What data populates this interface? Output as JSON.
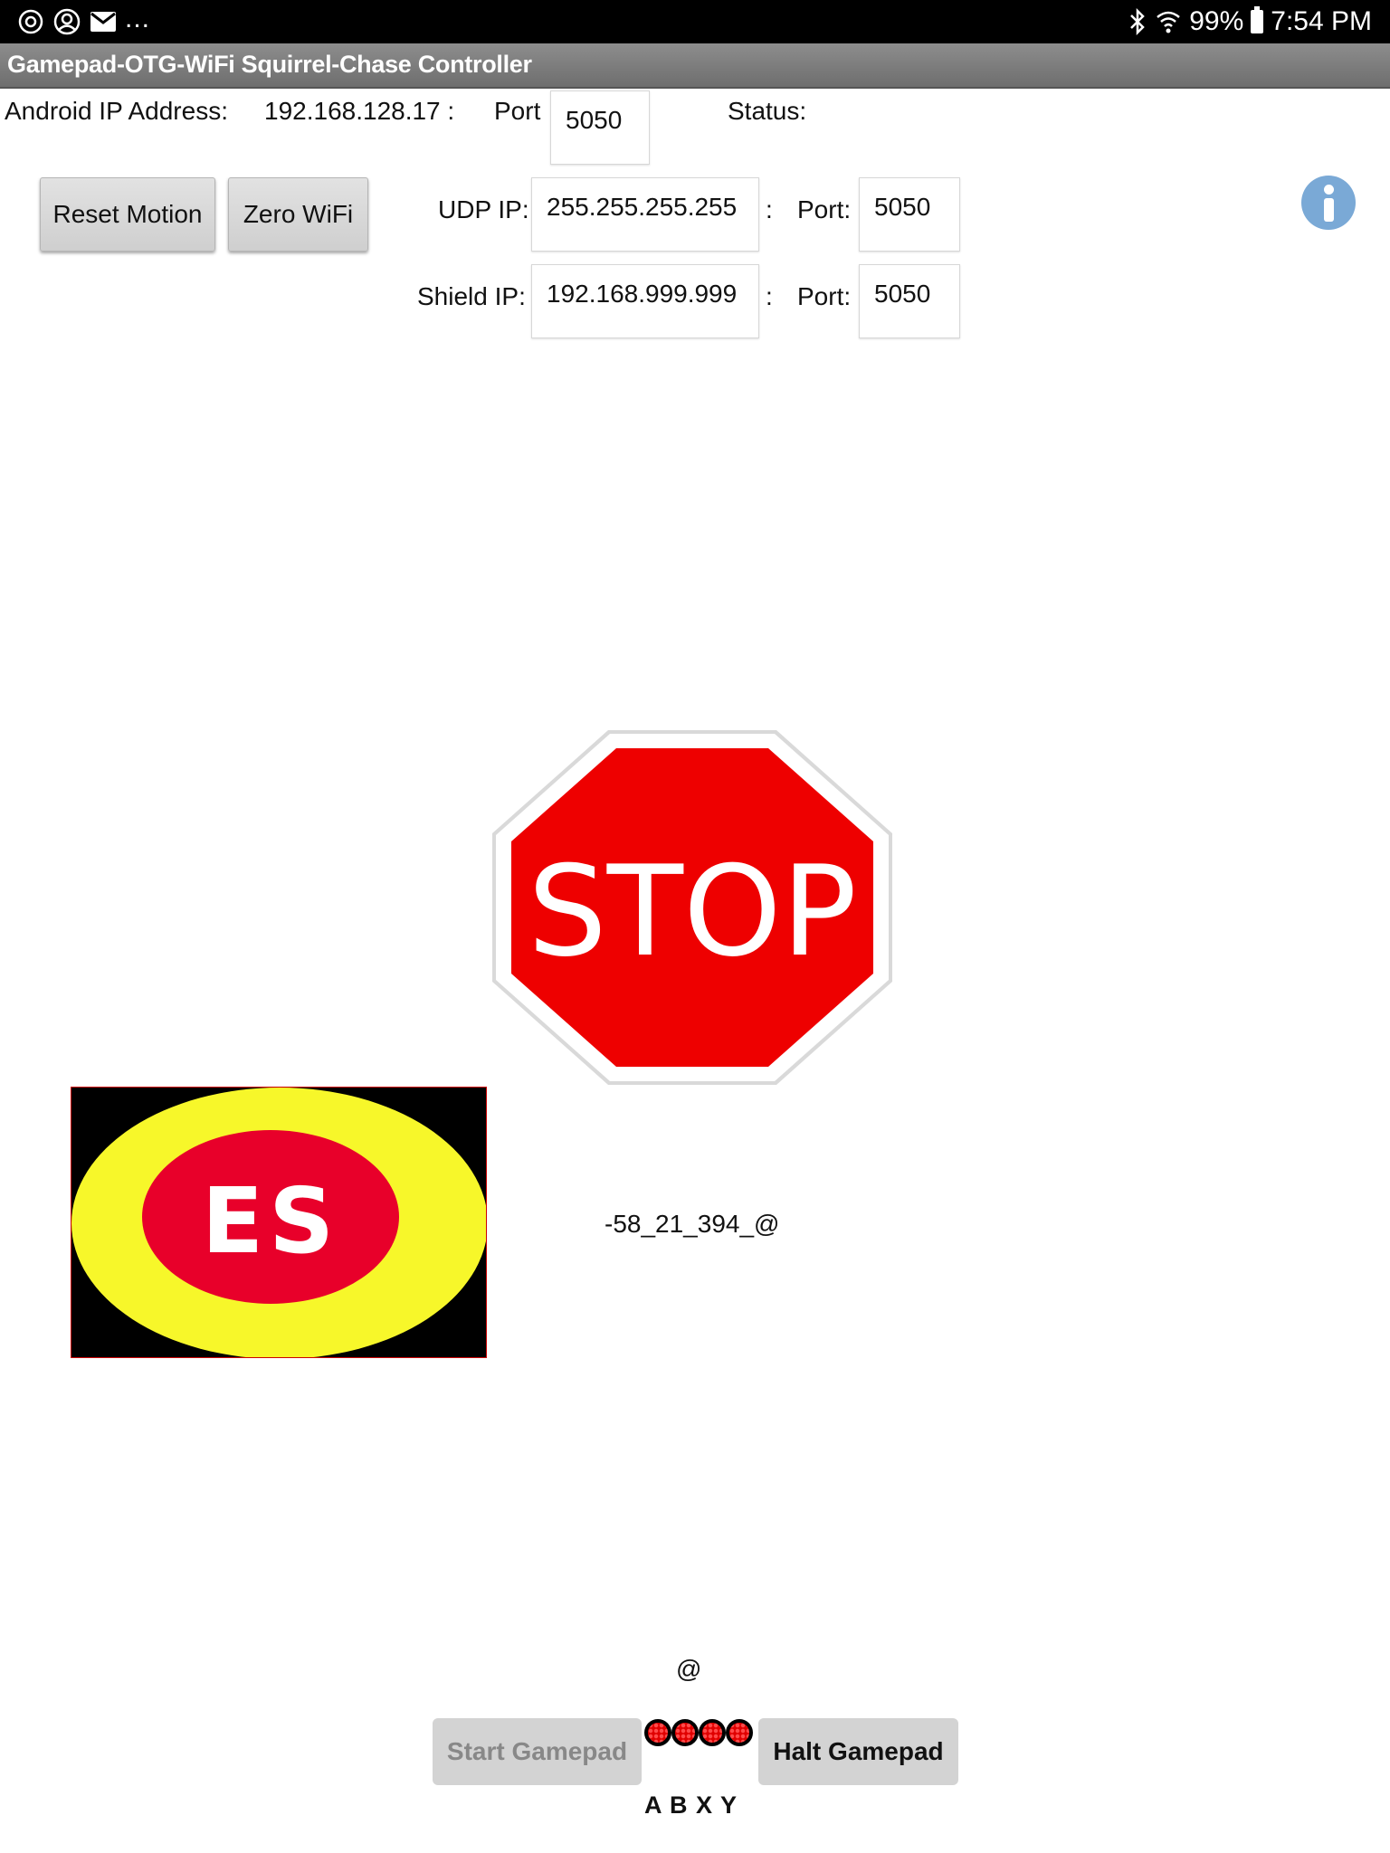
{
  "status_bar": {
    "notification_icons": [
      "settings-circle-icon",
      "account-circle-icon",
      "email-icon"
    ],
    "overflow_indicator": "...",
    "bluetooth_icon": "bluetooth-icon",
    "wifi_icon": "wifi-icon",
    "battery_percent": "99%",
    "battery_icon": "battery-icon",
    "time": "7:54 PM"
  },
  "app": {
    "title": "Gamepad-OTG-WiFi Squirrel-Chase Controller"
  },
  "network": {
    "android_ip_label": "Android IP Address:",
    "android_ip_value": "192.168.128.17 :",
    "port_label": "Port",
    "port_value": "5050",
    "status_label": "Status:",
    "status_value": ""
  },
  "buttons": {
    "reset_motion": "Reset Motion",
    "zero_wifi": "Zero WiFi"
  },
  "udp": {
    "ip_label": "UDP IP:",
    "ip_value": "255.255.255.255",
    "separator": ":",
    "port_label": "Port:",
    "port_value": "5050"
  },
  "shield": {
    "ip_label": "Shield IP:",
    "ip_value": "192.168.999.999",
    "separator": ":",
    "port_label": "Port:",
    "port_value": "5050"
  },
  "stop_sign": {
    "text": "STOP",
    "fill_color": "#ee0000",
    "border_color": "#ffffff"
  },
  "emergency_stop": {
    "text": "ES",
    "outer_color": "#f7f72a",
    "inner_color": "#e8002a",
    "background_color": "#000000"
  },
  "readout": {
    "value": "-58_21_394_@",
    "at_symbol": "@"
  },
  "gamepad": {
    "start_label": "Start Gamepad",
    "halt_label": "Halt Gamepad",
    "button_letters": "A B X Y",
    "led_color": "#e00000"
  },
  "colors": {
    "title_bar": "#7d7d7d",
    "info_icon": "#7aa9d6",
    "button_face": "#d8d8d8"
  }
}
